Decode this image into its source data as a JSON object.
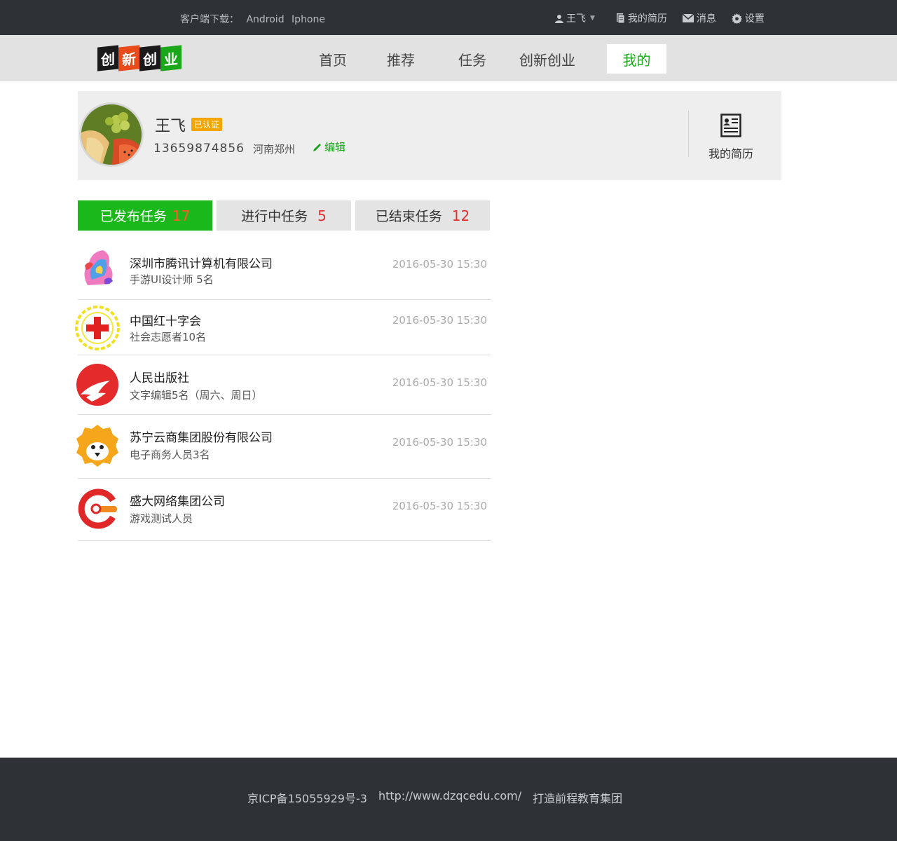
{
  "topbar": {
    "download_label": "客户端下载：",
    "download_android": "Android",
    "download_iphone": "Iphone",
    "user_name": "王飞",
    "user_caret": "▼",
    "resume_link": "我的简历",
    "messages_link": "消息",
    "settings_link": "设置"
  },
  "logo": {
    "chars": [
      "创",
      "新",
      "创",
      "业"
    ],
    "colors": [
      "#1a1a1a",
      "#e84a1a",
      "#1a1a1a",
      "#1aa81a"
    ]
  },
  "nav": {
    "items": [
      "首页",
      "推荐",
      "任务",
      "创新创业",
      "我的"
    ],
    "active": "我的"
  },
  "profile": {
    "name": "王飞",
    "badge": "已认证",
    "phone": "13659874856",
    "location": "河南郑州",
    "edit_label": "编辑",
    "resume_label": "我的简历"
  },
  "tabs": [
    {
      "label": "已发布任务",
      "count": "17"
    },
    {
      "label": "进行中任务",
      "count": "5"
    },
    {
      "label": "已结束任务",
      "count": "12"
    }
  ],
  "tasks": [
    {
      "title": "深圳市腾讯计算机有限公司",
      "subtitle": "手游UI设计师 5名",
      "time": "2016-05-30 15:30",
      "icon": "tencent-art-icon"
    },
    {
      "title": "中国红十字会",
      "subtitle": "社会志愿者10名",
      "time": "2016-05-30 15:30",
      "icon": "red-cross-icon"
    },
    {
      "title": "人民出版社",
      "subtitle": "文字编辑5名（周六、周日）",
      "time": "2016-05-30 15:30",
      "icon": "peoples-press-icon"
    },
    {
      "title": "苏宁云商集团股份有限公司",
      "subtitle": "电子商务人员3名",
      "time": "2016-05-30 15:30",
      "icon": "suning-lion-icon"
    },
    {
      "title": "盛大网络集团公司",
      "subtitle": "游戏测试人员",
      "time": "2016-05-30 15:30",
      "icon": "shanda-logo-icon"
    }
  ],
  "footer": {
    "icp": "京ICP备15055929号-3",
    "url": "http://www.dzqcedu.com/",
    "slogan": "打造前程教育集团"
  }
}
